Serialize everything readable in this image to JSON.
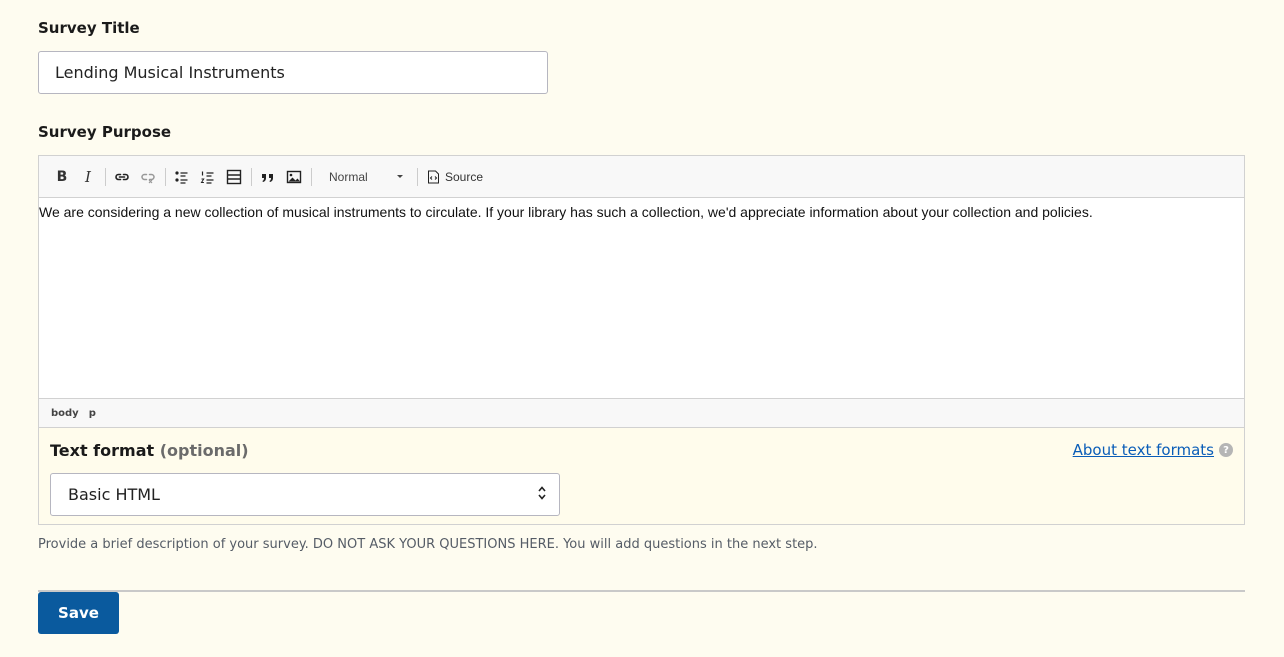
{
  "survey_title": {
    "label": "Survey Title",
    "value": "Lending Musical Instruments"
  },
  "survey_purpose": {
    "label": "Survey Purpose",
    "toolbar": {
      "bold_label": "B",
      "italic_label": "I",
      "format_select_value": "Normal",
      "source_label": "Source",
      "icons": [
        "bold-icon",
        "italic-icon",
        "link-icon",
        "unlink-icon",
        "bulleted-list-icon",
        "numbered-list-icon",
        "horizontal-rule-icon",
        "blockquote-icon",
        "image-icon",
        "source-icon"
      ]
    },
    "content": "We are considering a new collection of musical instruments to circulate. If your library has such a collection, we'd appreciate information about your collection and policies.",
    "path": [
      "body",
      "p"
    ],
    "text_format": {
      "label": "Text format",
      "optional": "(optional)",
      "help_link": "About text formats",
      "help_icon": "?",
      "selected": "Basic HTML"
    },
    "description": "Provide a brief description of your survey. DO NOT ASK YOUR QUESTIONS HERE. You will add questions in the next step."
  },
  "actions": {
    "save_label": "Save"
  },
  "colors": {
    "page_background": "#fefcf0",
    "primary_button": "#0a5a9e",
    "link": "#0a5db8"
  }
}
